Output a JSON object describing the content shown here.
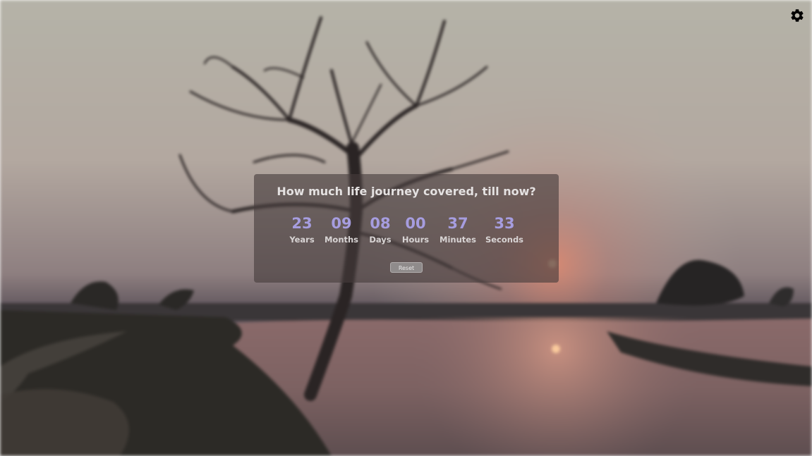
{
  "question": "How much life journey covered, till now?",
  "counters": [
    {
      "value": "23",
      "label": "Years"
    },
    {
      "value": "09",
      "label": "Months"
    },
    {
      "value": "08",
      "label": "Days"
    },
    {
      "value": "00",
      "label": "Hours"
    },
    {
      "value": "37",
      "label": "Minutes"
    },
    {
      "value": "33",
      "label": "Seconds"
    }
  ],
  "reset_label": "Reset",
  "settings_icon": "gear-icon",
  "colors": {
    "number": "#a69ddf",
    "label": "#d8d4d4",
    "panel": "#463c3c"
  }
}
